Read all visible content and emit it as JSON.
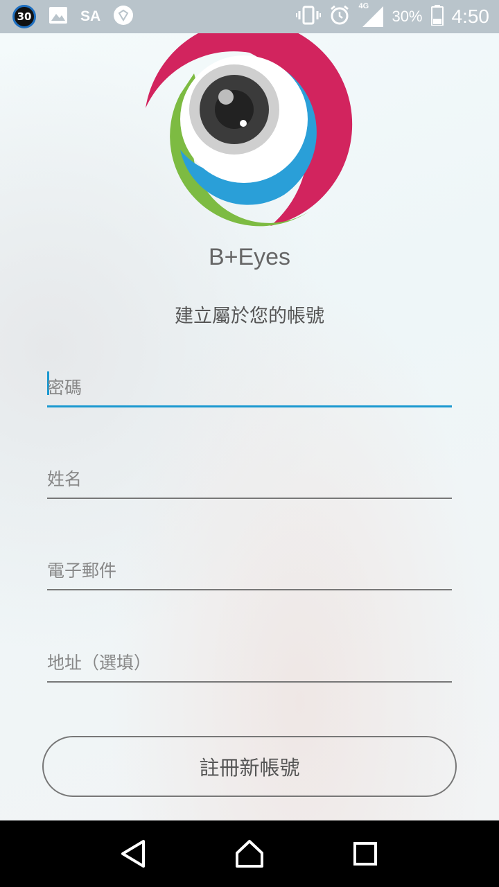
{
  "status_bar": {
    "notification_badge": "30",
    "carrier_text": "SA",
    "network": "4G",
    "battery": "30%",
    "time": "4:50",
    "icons": [
      "image-icon",
      "diamond-heart-icon",
      "vibrate-icon",
      "alarm-icon",
      "signal-icon",
      "battery-icon"
    ]
  },
  "app": {
    "name": "B+Eyes",
    "subtitle": "建立屬於您的帳號",
    "logo_colors": {
      "pink": "#d2245e",
      "blue": "#2a9fd8",
      "green": "#7dbb42",
      "gray": "#cfcfcf"
    }
  },
  "form": {
    "fields": [
      {
        "placeholder": "密碼",
        "value": ""
      },
      {
        "placeholder": "姓名",
        "value": ""
      },
      {
        "placeholder": "電子郵件",
        "value": ""
      },
      {
        "placeholder": "地址（選填）",
        "value": ""
      }
    ],
    "register_button": "註冊新帳號",
    "accent_color": "#1a98d0"
  },
  "nav": {
    "icons": [
      "back-icon",
      "home-icon",
      "recents-icon"
    ]
  }
}
